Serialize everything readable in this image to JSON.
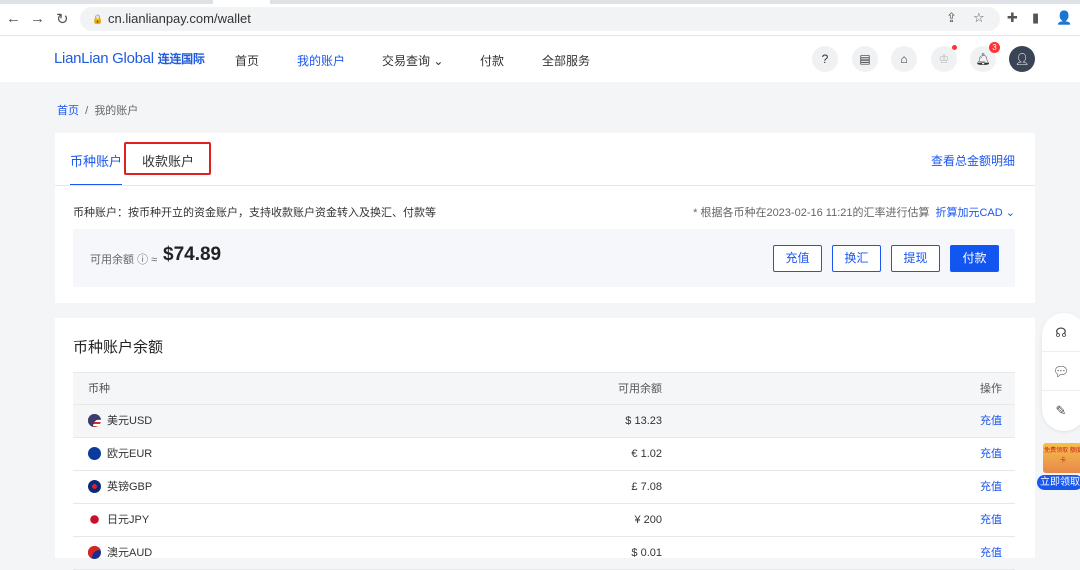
{
  "browser": {
    "url": "cn.lianlianpay.com/wallet"
  },
  "header": {
    "logo": "LianLian Global",
    "logo_cn": "连连国际",
    "menu": [
      "首页",
      "我的账户",
      "交易查询",
      "付款",
      "全部服务"
    ],
    "notification_count": "3"
  },
  "breadcrumb": {
    "home": "首页",
    "sep": "/",
    "current": "我的账户"
  },
  "account": {
    "tabs": [
      "币种账户",
      "收款账户"
    ],
    "view_all": "查看总金额明细",
    "desc": "币种账户：按币种开立的资金账户，支持收款账户资金转入及换汇、付款等",
    "note": "* 根据各币种在2023-02-16 11:21的汇率进行估算",
    "convert": "折算加元CAD",
    "balance_label": "可用余额",
    "balance_approx": "≈",
    "balance": "$74.89",
    "buttons": [
      "充值",
      "换汇",
      "提现",
      "付款"
    ]
  },
  "currencies": {
    "title": "币种账户余额",
    "headers": [
      "币种",
      "可用余额",
      "操作"
    ],
    "rows": [
      {
        "name": "美元USD",
        "amount": "$ 13.23",
        "action": "充值"
      },
      {
        "name": "欧元EUR",
        "amount": "€ 1.02",
        "action": "充值"
      },
      {
        "name": "英镑GBP",
        "amount": "£  7.08",
        "action": "充值"
      },
      {
        "name": "日元JPY",
        "amount": "¥  200",
        "action": "充值"
      },
      {
        "name": "澳元AUD",
        "amount": "$ 0.01",
        "action": "充值"
      }
    ]
  },
  "promo": {
    "top": "免费领取 额度卡",
    "cta": "立即领取"
  }
}
